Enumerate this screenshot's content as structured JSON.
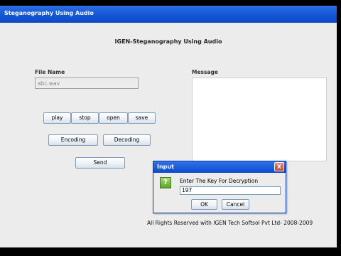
{
  "window": {
    "title": "Steganography Using Audio",
    "heading": "IGEN-Steganography Using Audio"
  },
  "file": {
    "label": "File Name",
    "value": "abc.wav"
  },
  "message": {
    "label": "Message",
    "value": ""
  },
  "audio_buttons": {
    "play": "play",
    "stop": "stop",
    "open": "open",
    "save": "save"
  },
  "actions": {
    "encoding": "Encoding",
    "decoding": "Decoding",
    "send": "Send"
  },
  "footer": "All Rights Reserved with  IGEN Tech Softsol Pvt Ltd- 2008-2009",
  "dialog": {
    "title": "Input",
    "prompt": "Enter The Key For  Decryption",
    "value": "197",
    "ok": "OK",
    "cancel": "Cancel",
    "close_glyph": "X",
    "icon_glyph": "?"
  },
  "icons": {
    "dialog_icon": "question-icon",
    "close": "close-icon"
  }
}
